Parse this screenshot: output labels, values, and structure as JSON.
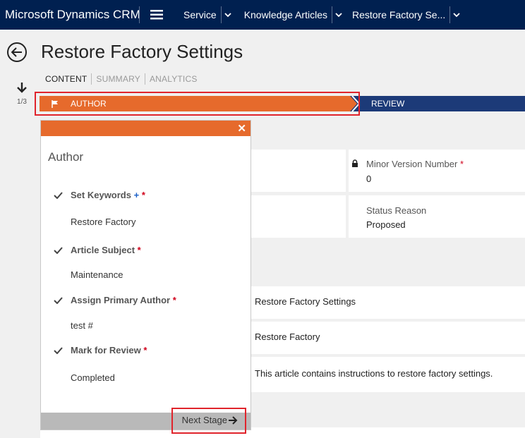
{
  "nav": {
    "app_title": "Microsoft Dynamics CRM",
    "items": [
      {
        "label": "Service"
      },
      {
        "label": "Knowledge Articles"
      },
      {
        "label": "Restore Factory Se..."
      }
    ]
  },
  "header": {
    "title": "Restore Factory Settings",
    "tabs": [
      "CONTENT",
      "SUMMARY",
      "ANALYTICS"
    ],
    "stage_count": "1/3"
  },
  "process": {
    "stages": [
      "AUTHOR",
      "REVIEW"
    ],
    "active_stage": "AUTHOR",
    "colors": {
      "active": "#e66a2c",
      "inactive": "#1c3a78"
    }
  },
  "form": {
    "minor_version": {
      "label": "Minor Version Number",
      "value": "0"
    },
    "status_reason": {
      "label": "Status Reason",
      "value": "Proposed"
    },
    "title_value": "Restore Factory Settings",
    "keywords_value": "Restore Factory",
    "description_value": "This article contains instructions to restore factory settings."
  },
  "flyout": {
    "title": "Author",
    "steps": [
      {
        "label": "Set Keywords",
        "value": "Restore Factory"
      },
      {
        "label": "Article Subject",
        "value": "Maintenance"
      },
      {
        "label": "Assign Primary Author",
        "value": "test #"
      },
      {
        "label": "Mark for Review",
        "value": "Completed"
      }
    ],
    "next_label": "Next Stage",
    "plus": "+",
    "required": "*",
    "close": "✕"
  }
}
